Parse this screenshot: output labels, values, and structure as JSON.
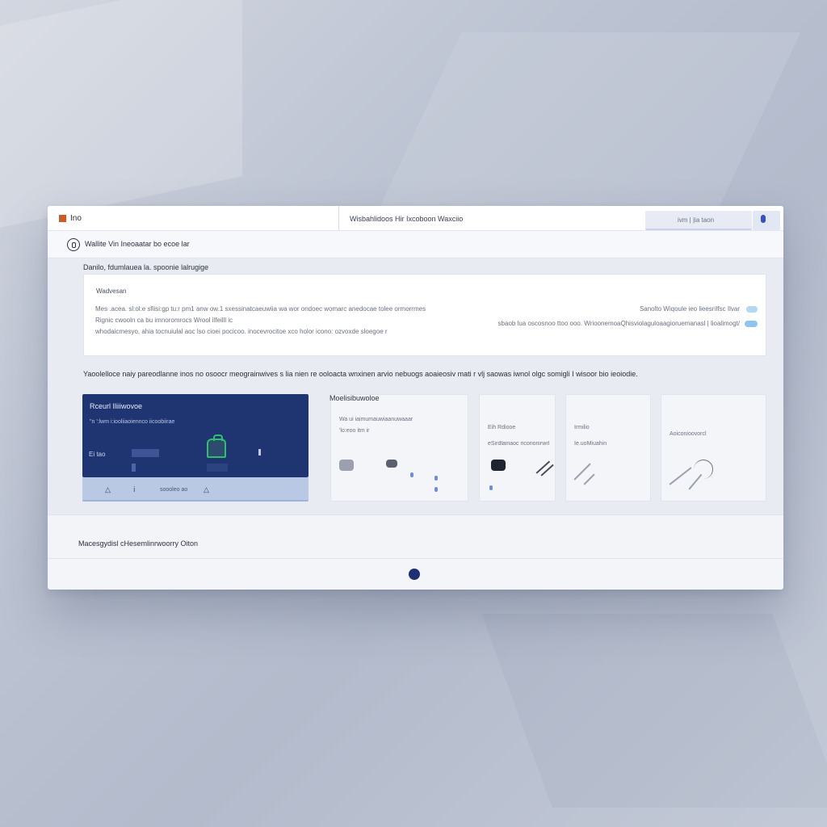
{
  "topbar": {
    "logo_text": "Ino",
    "title": "Wisbahlidoos Hir Ixcoboon Waxciio",
    "search_text": "ivm | |ia taon",
    "colors": {
      "logo": "#d25a1c",
      "avatar": "#3b4fc4"
    }
  },
  "subbar": {
    "back_icon": "back-circle-icon",
    "title": "Wallite Vin Ineoaatar bo ecoe lar"
  },
  "settings": {
    "heading": "Danilo, fdumlauea la. spoonie lalrugige",
    "card_label": "Wadvesan",
    "lines": [
      "Mes .acea. sl:ol:e sfiisi:gp tu:r pm1 anw ow.1 sxessinatcaeuwiia wa wor ondoec womarc anedocae tolee ormorrmes",
      "Rignic cwooln ca    bu imnoromrocs Wrool ilfeilll ic",
      "whodaicmesyo, ahia    tocnuiulal aoc lso cioei pocicoo. inocevrocitoe xco holor icono: ozvoxde sloegoe r"
    ],
    "right_lines": [
      "Sanolto     Wiqoule ieo lieesriIfsc Ilvar",
      "sbaob lua oscosnoo ttoo ooo. WrioonemoaQhisviolaguloaagioruemanasl | lioalimogt/"
    ],
    "accent_color": "#8fc4f0"
  },
  "description": "Yaoolelloce naiy pareodlanne inos no osoocr meograinwives s lia nien re ooloacta  wnxinen arvio nebuogs aoaieosiv mati r vlj saowas iwnol olgc somigli I wisoor bio ieoiodie.",
  "tiles": {
    "dark": {
      "title": "Rceurl Iliiiwovoe",
      "subtitle": "\"n ':lwm i:iooliiaoiennco iicoobiirae",
      "left_label": "Ei tao",
      "foot_text": "soooleo ao",
      "colors": {
        "bg": "#1f3572",
        "foot": "#b9c8e3",
        "icon": "#2ec06a"
      }
    },
    "section_title": "Moelisibuwoloe",
    "cards": [
      {
        "line1": "Wa ui iaimumauwiaanuwaaar",
        "line2": "'lo:eoo itm ir"
      },
      {
        "line1": "Eih Rdiooe",
        "line2": "eSirdlairiaoc ricorioriirwrl"
      },
      {
        "line1": "Irmilio",
        "line2": "Ie.uoMiuahin"
      },
      {
        "line1": "Aoiconioovorcl",
        "line2": ""
      }
    ]
  },
  "footer": {
    "text": "Macesgydisl cHesemlinrwoorry Oiton",
    "pager_color": "#1f2f74"
  }
}
